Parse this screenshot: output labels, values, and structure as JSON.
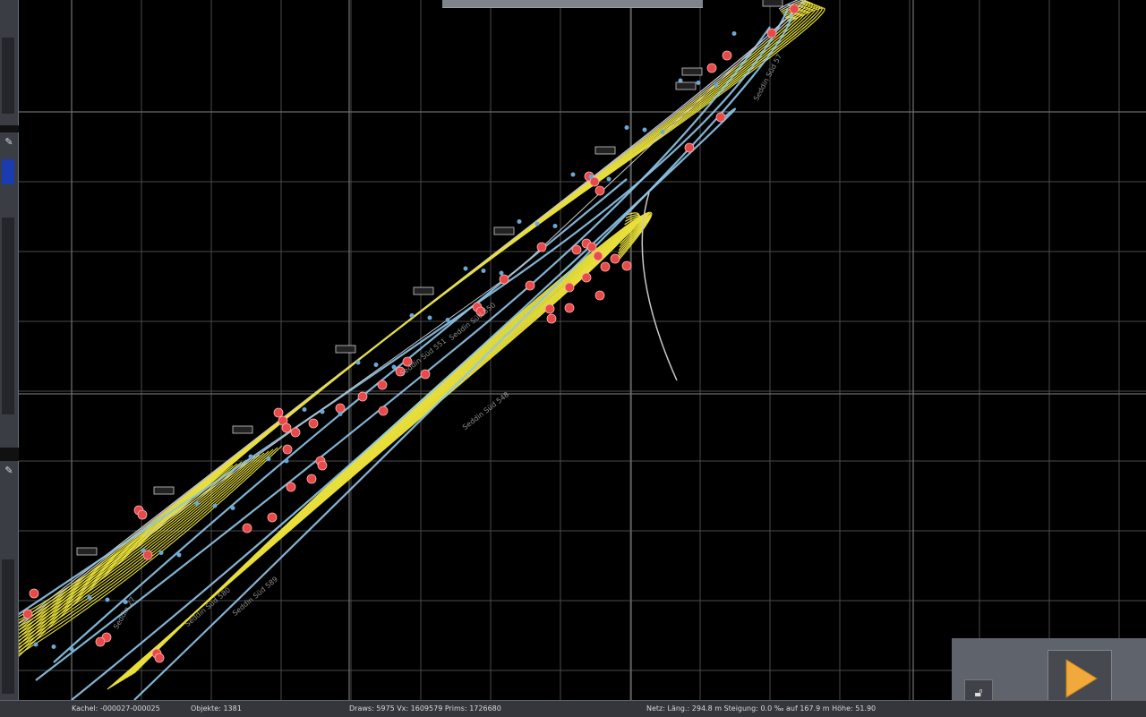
{
  "status_bar": {
    "kachel": "Kachel: -000027-000025",
    "objekte": "Objekte: 1381",
    "draws": "Draws: 5975 Vx: 1609579 Prims: 1726680",
    "netz": "Netz: Läng.: 294.8 m Steigung: 0.0 ‰ auf 167.9 m Höhe: 51.90"
  },
  "map_labels": {
    "l1": "Seddin Süd 550",
    "l2": "Seddin Süd 548",
    "l3": "Seddin Süd 551",
    "l4": "Seddin Süd 580",
    "l5": "Seddin Süd 589",
    "l6": "Seddin 27",
    "l7": "Seddin Süd 57"
  },
  "icons": {
    "pin": "pin-icon",
    "lock": "unlock-icon",
    "play": "play-icon"
  },
  "colors": {
    "background": "#000000",
    "grid": "#4a4a4a",
    "track_yellow": "#e8df3c",
    "track_blue": "#8fc8ea",
    "track_white": "#c8c8c8",
    "signal_red": "#e84a4a",
    "play_orange": "#f2a93b"
  }
}
